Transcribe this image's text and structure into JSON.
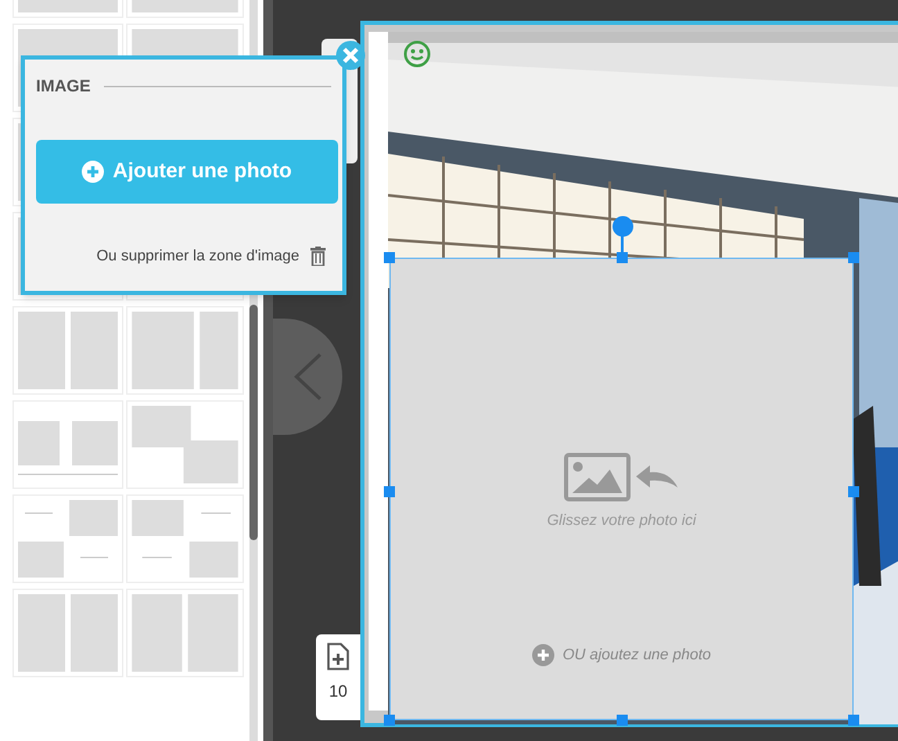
{
  "image_popup": {
    "title": "IMAGE",
    "add_button": "Ajouter une photo",
    "delete_text": "Ou supprimer la zone d'image"
  },
  "image_zone": {
    "hint": "Glissez votre photo ici",
    "add_link": "OU ajoutez une photo"
  },
  "page_add": {
    "count": "10"
  }
}
